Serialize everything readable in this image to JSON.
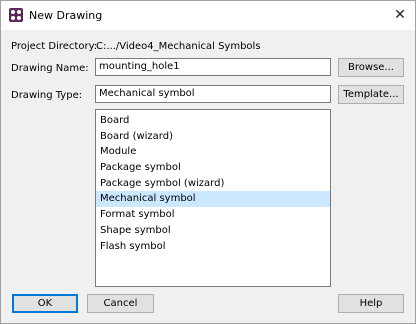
{
  "window": {
    "title": "New Drawing",
    "close_glyph": "✕"
  },
  "project": {
    "label": "Project Directory:",
    "value": "C:.../Video4_Mechanical Symbols"
  },
  "name": {
    "label": "Drawing Name:",
    "value": "mounting_hole1",
    "browse_label": "Browse..."
  },
  "type": {
    "label": "Drawing Type:",
    "value": "Mechanical symbol",
    "template_label": "Template..."
  },
  "drawing_types": [
    "Board",
    "Board (wizard)",
    "Module",
    "Package symbol",
    "Package symbol (wizard)",
    "Mechanical symbol",
    "Format symbol",
    "Shape symbol",
    "Flash symbol"
  ],
  "selected_type": "Mechanical symbol",
  "footer": {
    "ok_label": "OK",
    "cancel_label": "Cancel",
    "help_label": "Help"
  },
  "colors": {
    "selection": "#cce8ff",
    "default_button_border": "#0078d7"
  },
  "icons": {
    "app": "app-icon",
    "close": "close-icon"
  }
}
